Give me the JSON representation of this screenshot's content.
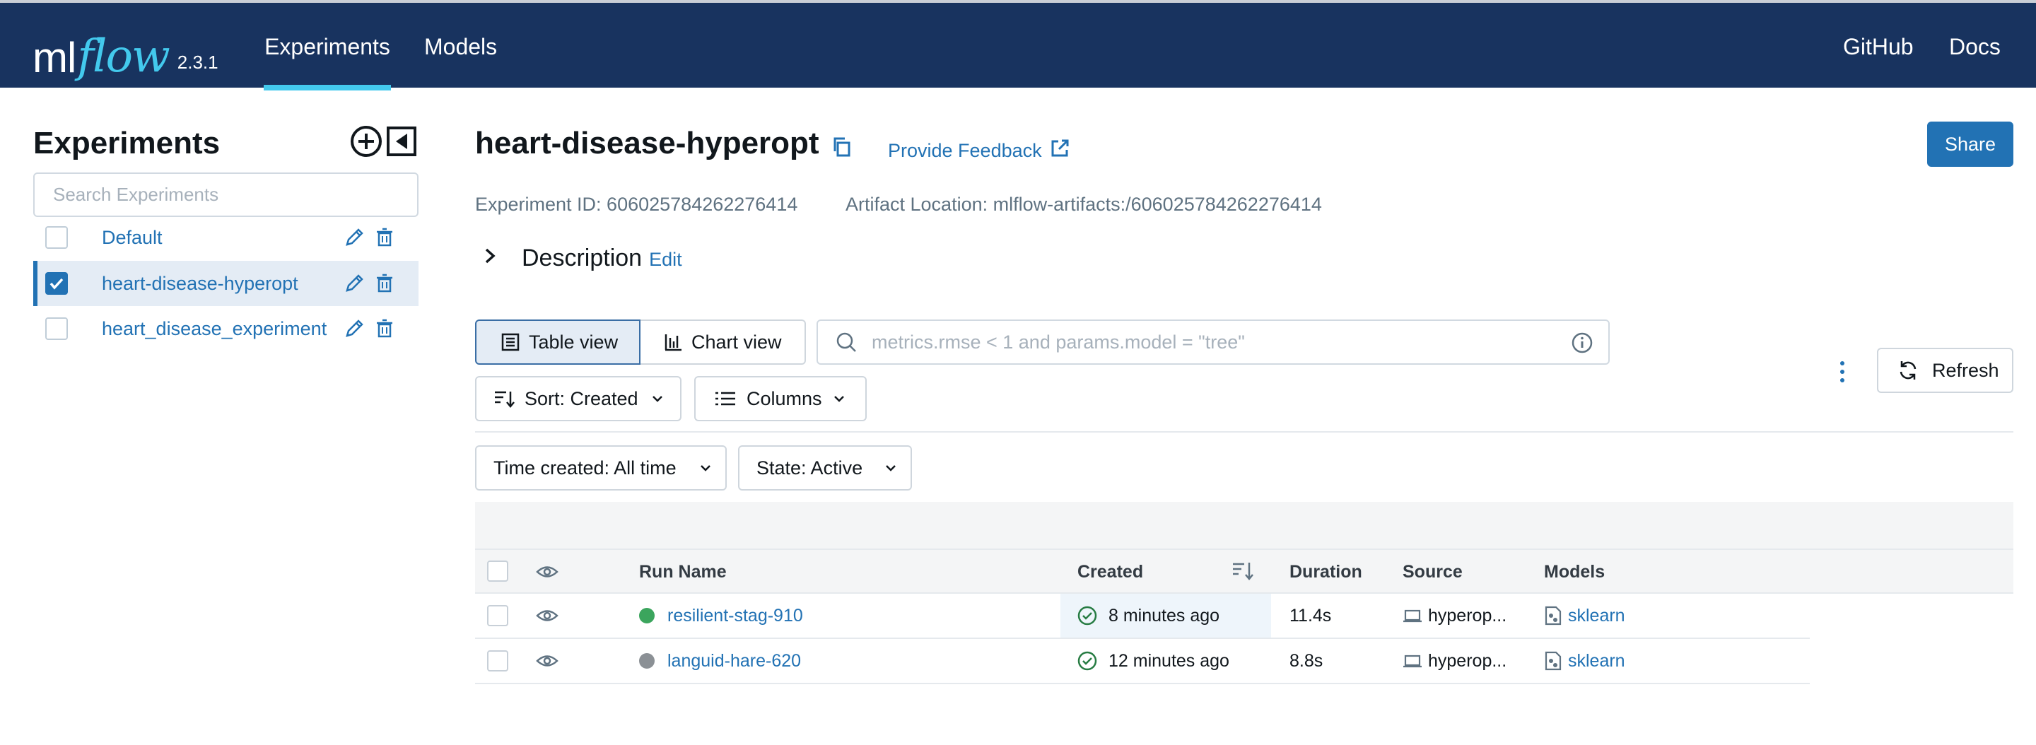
{
  "header": {
    "logo_ml": "ml",
    "logo_flow": "flow",
    "version": "2.3.1",
    "tabs": [
      {
        "label": "Experiments",
        "active": true
      },
      {
        "label": "Models",
        "active": false
      }
    ],
    "links": [
      "GitHub",
      "Docs"
    ],
    "accent_color": "#43c9ed",
    "bg_color": "#18335f"
  },
  "sidebar": {
    "title": "Experiments",
    "search_placeholder": "Search Experiments",
    "experiments": [
      {
        "name": "Default",
        "selected": false
      },
      {
        "name": "heart-disease-hyperopt",
        "selected": true
      },
      {
        "name": "heart_disease_experiment",
        "selected": false
      }
    ]
  },
  "experiment": {
    "title": "heart-disease-hyperopt",
    "feedback_label": "Provide Feedback",
    "share_label": "Share",
    "id_text": "Experiment ID: 606025784262276414",
    "artifact_text": "Artifact Location: mlflow-artifacts:/606025784262276414",
    "description_label": "Description",
    "description_edit": "Edit"
  },
  "toolbar": {
    "table_view": "Table view",
    "chart_view": "Chart view",
    "search_placeholder": "metrics.rmse < 1 and params.model = \"tree\"",
    "refresh": "Refresh",
    "sort": "Sort: Created",
    "columns": "Columns",
    "time_filter": "Time created: All time",
    "state_filter": "State: Active"
  },
  "table": {
    "headers": {
      "run_name": "Run Name",
      "created": "Created",
      "duration": "Duration",
      "source": "Source",
      "models": "Models"
    },
    "rows": [
      {
        "run_name": "resilient-stag-910",
        "status_color": "#3ba55d",
        "created": "8 minutes ago",
        "duration": "11.4s",
        "source": "hyperop...",
        "model": "sklearn"
      },
      {
        "run_name": "languid-hare-620",
        "status_color": "#8b9095",
        "created": "12 minutes ago",
        "duration": "8.8s",
        "source": "hyperop...",
        "model": "sklearn"
      }
    ]
  }
}
